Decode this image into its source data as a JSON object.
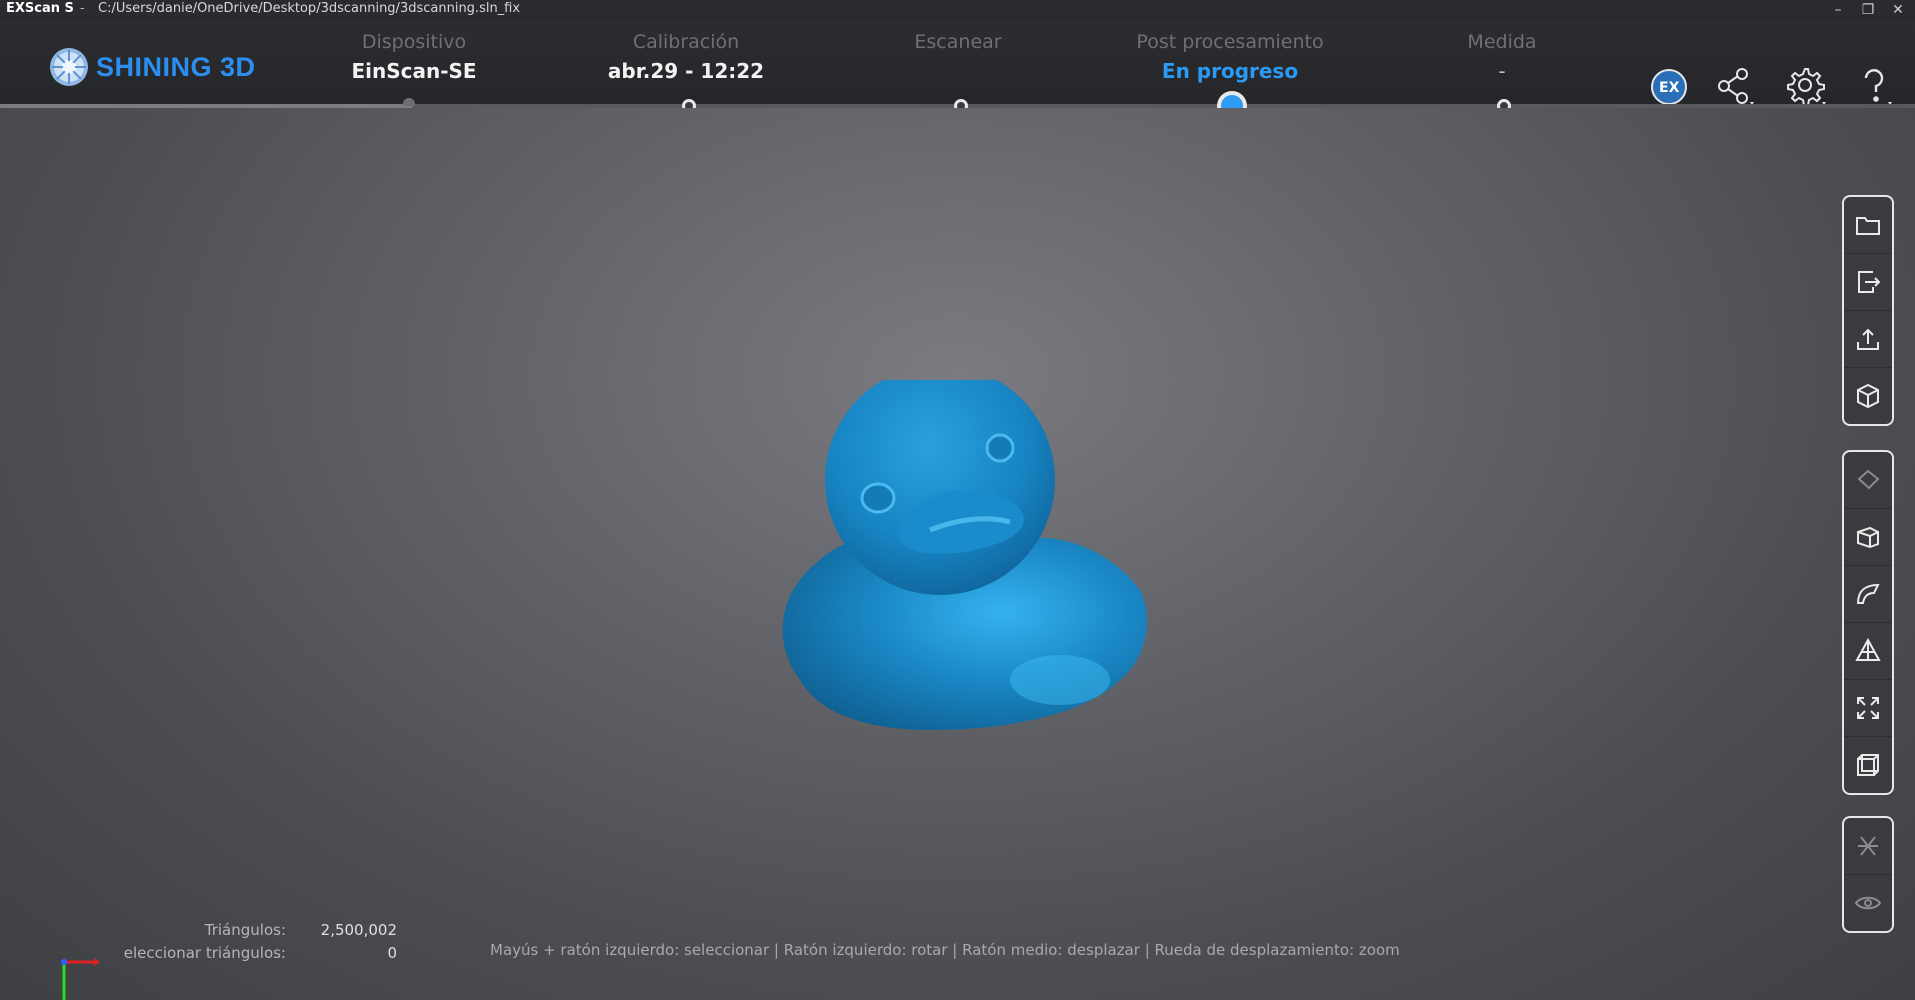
{
  "titlebar": {
    "app": "EXScan S",
    "separator": "-",
    "path": "C:/Users/danie/OneDrive/Desktop/3dscanning/3dscanning.sln_fix"
  },
  "logo": {
    "name": "SHINING 3D"
  },
  "steps": [
    {
      "label": "Dispositivo",
      "value": "EinScan-SE"
    },
    {
      "label": "Calibración",
      "value": "abr.29 - 12:22"
    },
    {
      "label": "Escanear",
      "value": ""
    },
    {
      "label": "Post procesamiento",
      "value": "En progreso"
    },
    {
      "label": "Medida",
      "value": "-"
    }
  ],
  "header_icons": [
    "ex-model-icon",
    "share-icon",
    "settings-icon",
    "help-icon"
  ],
  "toolbar": {
    "file": [
      "open-folder-icon",
      "export-icon",
      "upload-icon",
      "model-cube-icon"
    ],
    "edit": [
      "eraser-icon",
      "cube-cut-icon",
      "surface-icon",
      "mesh-triangle-icon",
      "fit-view-icon",
      "wireframe-box-icon"
    ],
    "view": [
      "symmetry-icon",
      "visibility-eye-icon"
    ]
  },
  "stats": {
    "triangles_label": "Triángulos:",
    "triangles_value": "2,500,002",
    "selected_label": "eleccionar triángulos:",
    "selected_value": "0"
  },
  "hint": "Mayús + ratón izquierdo: seleccionar | Ratón izquierdo: rotar | Ratón medio: desplazar | Rueda de desplazamiento: zoom",
  "colors": {
    "accent": "#2b9af3",
    "brand": "#2b8ff0",
    "model": "#1b8fd0"
  }
}
